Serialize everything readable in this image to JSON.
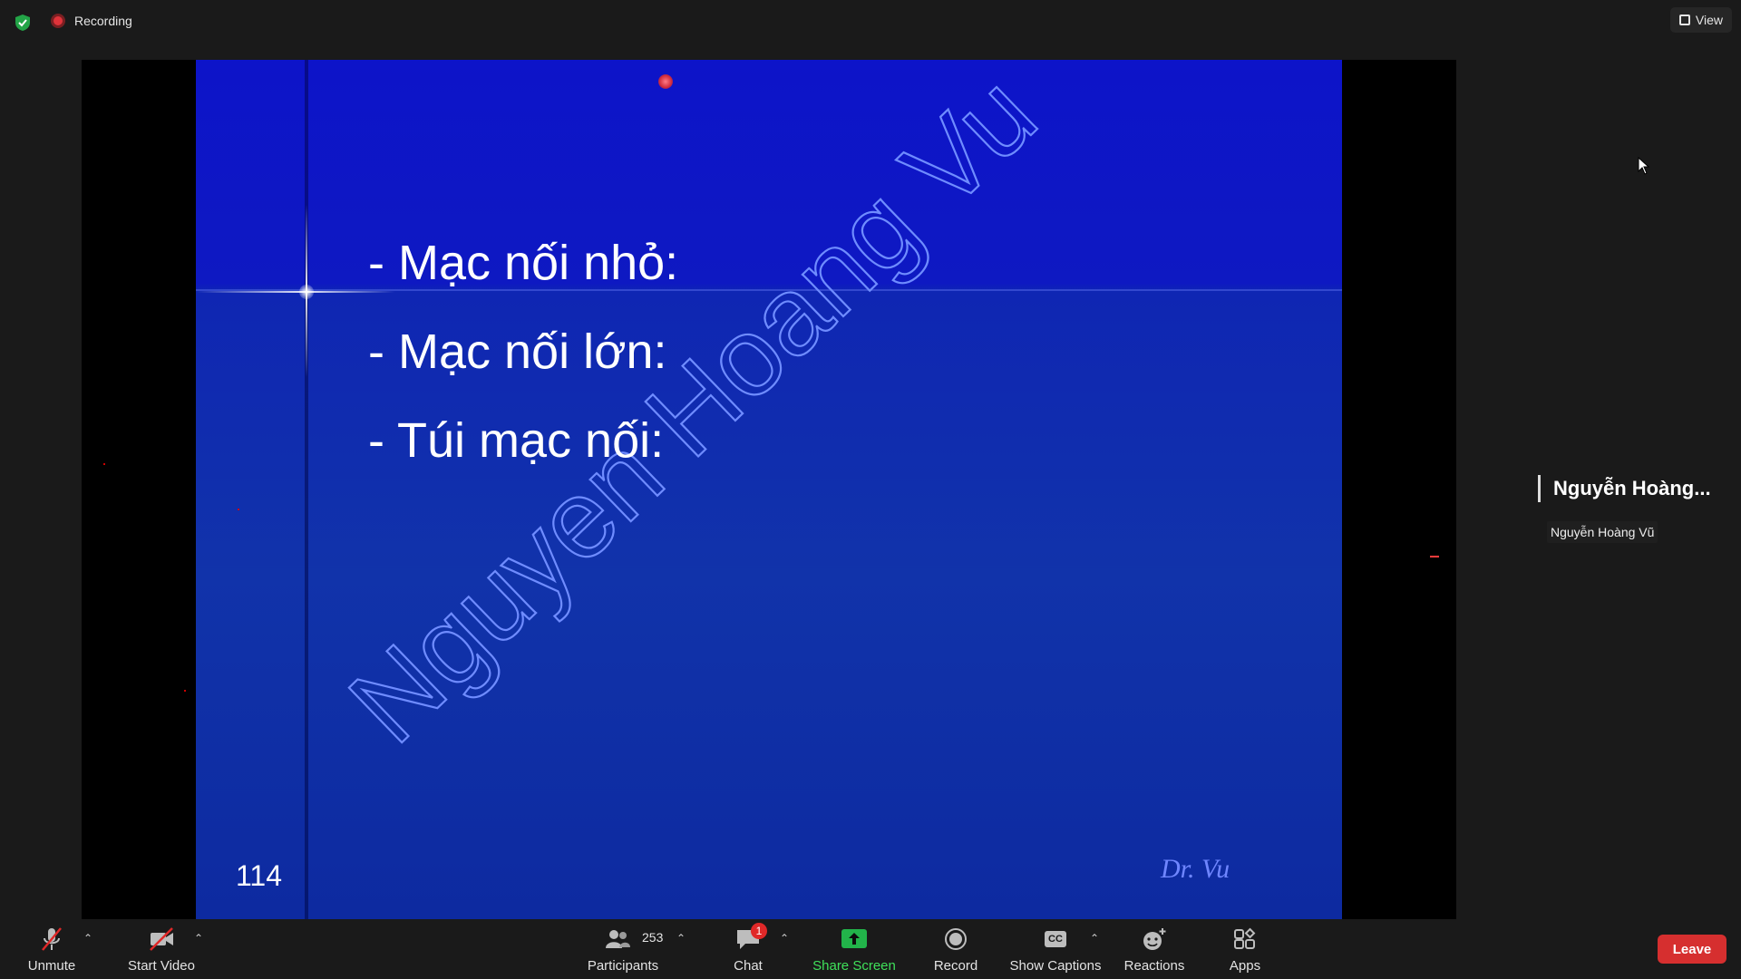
{
  "header": {
    "recording_label": "Recording",
    "view_label": "View"
  },
  "slide": {
    "bullets": [
      "- Mạc nối nhỏ:",
      "- Mạc nối lớn:",
      "- Túi mạc nối:"
    ],
    "page_number": "114",
    "signature": "Dr. Vu",
    "watermark": "Nguyen Hoang Vu"
  },
  "speaker": {
    "display_name": "Nguyễn Hoàng...",
    "full_name": "Nguyễn Hoàng Vũ"
  },
  "toolbar": {
    "unmute": "Unmute",
    "start_video": "Start Video",
    "participants": "Participants",
    "participants_count": "253",
    "chat": "Chat",
    "chat_badge": "1",
    "share_screen": "Share Screen",
    "record": "Record",
    "show_captions": "Show Captions",
    "cc_icon_text": "CC",
    "reactions": "Reactions",
    "apps": "Apps",
    "leave": "Leave"
  },
  "colors": {
    "background": "#1a1a1a",
    "leave": "#d62f2f",
    "share": "#3fe05a",
    "slide_blue": "#0f26b3"
  }
}
